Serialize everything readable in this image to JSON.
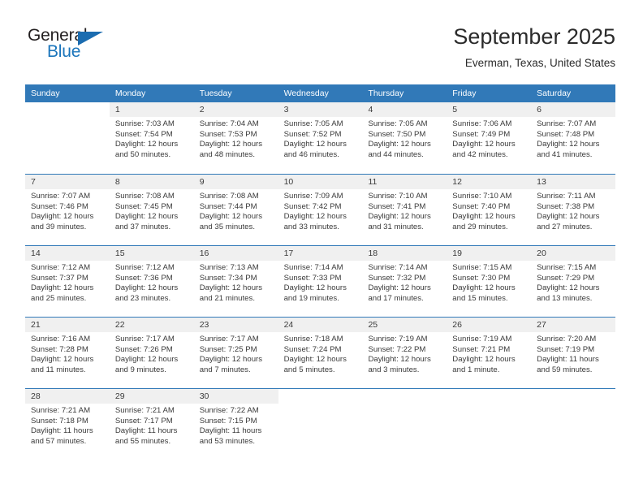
{
  "brand": {
    "name_part1": "General",
    "name_part2": "Blue",
    "accent_color": "#1b75bb",
    "triangle_color": "#1b6cb0"
  },
  "header": {
    "month_title": "September 2025",
    "location": "Everman, Texas, United States"
  },
  "theme": {
    "header_bar_color": "#3179b8",
    "daynum_band_color": "#f0f0f0",
    "text_color": "#3a3a3a"
  },
  "calendar": {
    "weekdays": [
      "Sunday",
      "Monday",
      "Tuesday",
      "Wednesday",
      "Thursday",
      "Friday",
      "Saturday"
    ],
    "weeks": [
      [
        {
          "day": "",
          "lines": []
        },
        {
          "day": "1",
          "lines": [
            "Sunrise: 7:03 AM",
            "Sunset: 7:54 PM",
            "Daylight: 12 hours",
            "and 50 minutes."
          ]
        },
        {
          "day": "2",
          "lines": [
            "Sunrise: 7:04 AM",
            "Sunset: 7:53 PM",
            "Daylight: 12 hours",
            "and 48 minutes."
          ]
        },
        {
          "day": "3",
          "lines": [
            "Sunrise: 7:05 AM",
            "Sunset: 7:52 PM",
            "Daylight: 12 hours",
            "and 46 minutes."
          ]
        },
        {
          "day": "4",
          "lines": [
            "Sunrise: 7:05 AM",
            "Sunset: 7:50 PM",
            "Daylight: 12 hours",
            "and 44 minutes."
          ]
        },
        {
          "day": "5",
          "lines": [
            "Sunrise: 7:06 AM",
            "Sunset: 7:49 PM",
            "Daylight: 12 hours",
            "and 42 minutes."
          ]
        },
        {
          "day": "6",
          "lines": [
            "Sunrise: 7:07 AM",
            "Sunset: 7:48 PM",
            "Daylight: 12 hours",
            "and 41 minutes."
          ]
        }
      ],
      [
        {
          "day": "7",
          "lines": [
            "Sunrise: 7:07 AM",
            "Sunset: 7:46 PM",
            "Daylight: 12 hours",
            "and 39 minutes."
          ]
        },
        {
          "day": "8",
          "lines": [
            "Sunrise: 7:08 AM",
            "Sunset: 7:45 PM",
            "Daylight: 12 hours",
            "and 37 minutes."
          ]
        },
        {
          "day": "9",
          "lines": [
            "Sunrise: 7:08 AM",
            "Sunset: 7:44 PM",
            "Daylight: 12 hours",
            "and 35 minutes."
          ]
        },
        {
          "day": "10",
          "lines": [
            "Sunrise: 7:09 AM",
            "Sunset: 7:42 PM",
            "Daylight: 12 hours",
            "and 33 minutes."
          ]
        },
        {
          "day": "11",
          "lines": [
            "Sunrise: 7:10 AM",
            "Sunset: 7:41 PM",
            "Daylight: 12 hours",
            "and 31 minutes."
          ]
        },
        {
          "day": "12",
          "lines": [
            "Sunrise: 7:10 AM",
            "Sunset: 7:40 PM",
            "Daylight: 12 hours",
            "and 29 minutes."
          ]
        },
        {
          "day": "13",
          "lines": [
            "Sunrise: 7:11 AM",
            "Sunset: 7:38 PM",
            "Daylight: 12 hours",
            "and 27 minutes."
          ]
        }
      ],
      [
        {
          "day": "14",
          "lines": [
            "Sunrise: 7:12 AM",
            "Sunset: 7:37 PM",
            "Daylight: 12 hours",
            "and 25 minutes."
          ]
        },
        {
          "day": "15",
          "lines": [
            "Sunrise: 7:12 AM",
            "Sunset: 7:36 PM",
            "Daylight: 12 hours",
            "and 23 minutes."
          ]
        },
        {
          "day": "16",
          "lines": [
            "Sunrise: 7:13 AM",
            "Sunset: 7:34 PM",
            "Daylight: 12 hours",
            "and 21 minutes."
          ]
        },
        {
          "day": "17",
          "lines": [
            "Sunrise: 7:14 AM",
            "Sunset: 7:33 PM",
            "Daylight: 12 hours",
            "and 19 minutes."
          ]
        },
        {
          "day": "18",
          "lines": [
            "Sunrise: 7:14 AM",
            "Sunset: 7:32 PM",
            "Daylight: 12 hours",
            "and 17 minutes."
          ]
        },
        {
          "day": "19",
          "lines": [
            "Sunrise: 7:15 AM",
            "Sunset: 7:30 PM",
            "Daylight: 12 hours",
            "and 15 minutes."
          ]
        },
        {
          "day": "20",
          "lines": [
            "Sunrise: 7:15 AM",
            "Sunset: 7:29 PM",
            "Daylight: 12 hours",
            "and 13 minutes."
          ]
        }
      ],
      [
        {
          "day": "21",
          "lines": [
            "Sunrise: 7:16 AM",
            "Sunset: 7:28 PM",
            "Daylight: 12 hours",
            "and 11 minutes."
          ]
        },
        {
          "day": "22",
          "lines": [
            "Sunrise: 7:17 AM",
            "Sunset: 7:26 PM",
            "Daylight: 12 hours",
            "and 9 minutes."
          ]
        },
        {
          "day": "23",
          "lines": [
            "Sunrise: 7:17 AM",
            "Sunset: 7:25 PM",
            "Daylight: 12 hours",
            "and 7 minutes."
          ]
        },
        {
          "day": "24",
          "lines": [
            "Sunrise: 7:18 AM",
            "Sunset: 7:24 PM",
            "Daylight: 12 hours",
            "and 5 minutes."
          ]
        },
        {
          "day": "25",
          "lines": [
            "Sunrise: 7:19 AM",
            "Sunset: 7:22 PM",
            "Daylight: 12 hours",
            "and 3 minutes."
          ]
        },
        {
          "day": "26",
          "lines": [
            "Sunrise: 7:19 AM",
            "Sunset: 7:21 PM",
            "Daylight: 12 hours",
            "and 1 minute."
          ]
        },
        {
          "day": "27",
          "lines": [
            "Sunrise: 7:20 AM",
            "Sunset: 7:19 PM",
            "Daylight: 11 hours",
            "and 59 minutes."
          ]
        }
      ],
      [
        {
          "day": "28",
          "lines": [
            "Sunrise: 7:21 AM",
            "Sunset: 7:18 PM",
            "Daylight: 11 hours",
            "and 57 minutes."
          ]
        },
        {
          "day": "29",
          "lines": [
            "Sunrise: 7:21 AM",
            "Sunset: 7:17 PM",
            "Daylight: 11 hours",
            "and 55 minutes."
          ]
        },
        {
          "day": "30",
          "lines": [
            "Sunrise: 7:22 AM",
            "Sunset: 7:15 PM",
            "Daylight: 11 hours",
            "and 53 minutes."
          ]
        },
        {
          "day": "",
          "lines": []
        },
        {
          "day": "",
          "lines": []
        },
        {
          "day": "",
          "lines": []
        },
        {
          "day": "",
          "lines": []
        }
      ]
    ]
  }
}
